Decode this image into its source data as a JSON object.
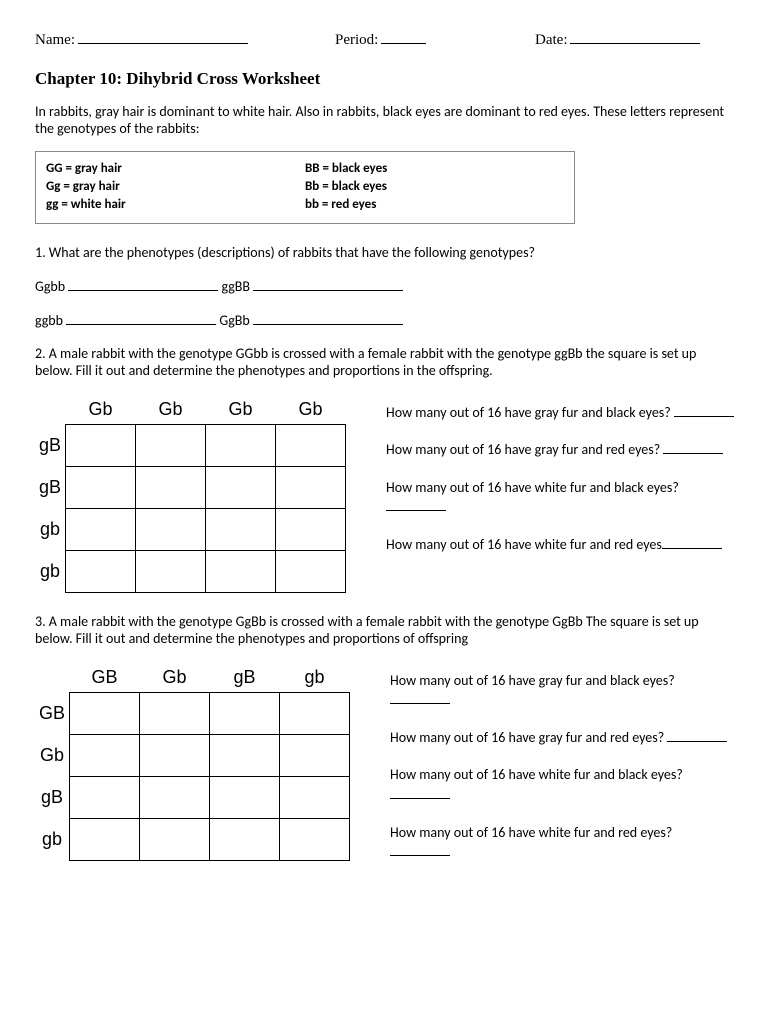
{
  "header": {
    "name_label": "Name:",
    "period_label": "Period:",
    "date_label": "Date:"
  },
  "title": "Chapter 10: Dihybrid Cross Worksheet",
  "intro": "In rabbits, gray hair is dominant to white hair. Also in rabbits, black eyes are dominant to red eyes. These letters represent the genotypes of the rabbits:",
  "genotype_key": {
    "col1": [
      "GG = gray hair",
      "Gg = gray hair",
      "gg = white hair"
    ],
    "col2": [
      "BB = black eyes",
      "Bb = black eyes",
      "bb = red eyes"
    ]
  },
  "q1": {
    "text": "1. What are the phenotypes (descriptions) of rabbits that have the following genotypes?",
    "row1": {
      "a": "Ggbb",
      "b": "ggBB"
    },
    "row2": {
      "a": "ggbb",
      "b": "GgBb"
    }
  },
  "q2": {
    "text": "2. A male rabbit with the genotype GGbb is crossed with a female rabbit with the genotype ggBb the square is set up below. Fill it out and determine the phenotypes and proportions in the offspring.",
    "top": [
      "Gb",
      "Gb",
      "Gb",
      "Gb"
    ],
    "side": [
      "gB",
      "gB",
      "gb",
      "gb"
    ],
    "sub": [
      "How many out of 16 have gray fur and black eyes?",
      "How many out of 16 have gray fur and red eyes?",
      "How many out of 16 have white fur and black eyes?",
      "How many out of 16 have white fur and red eyes"
    ]
  },
  "q3": {
    "text": "3. A male rabbit with the genotype GgBb is crossed with a female rabbit with the genotype GgBb The square is set up below. Fill it out and determine the phenotypes and proportions of offspring",
    "top": [
      "GB",
      "Gb",
      "gB",
      "gb"
    ],
    "side": [
      "GB",
      "Gb",
      "gB",
      "gb"
    ],
    "sub": [
      "How many out of 16 have gray fur and black eyes?",
      "How many out of 16 have gray fur and red eyes?",
      "How many out of 16 have white fur and black eyes?",
      "How many out of 16 have white fur and red eyes?"
    ]
  }
}
